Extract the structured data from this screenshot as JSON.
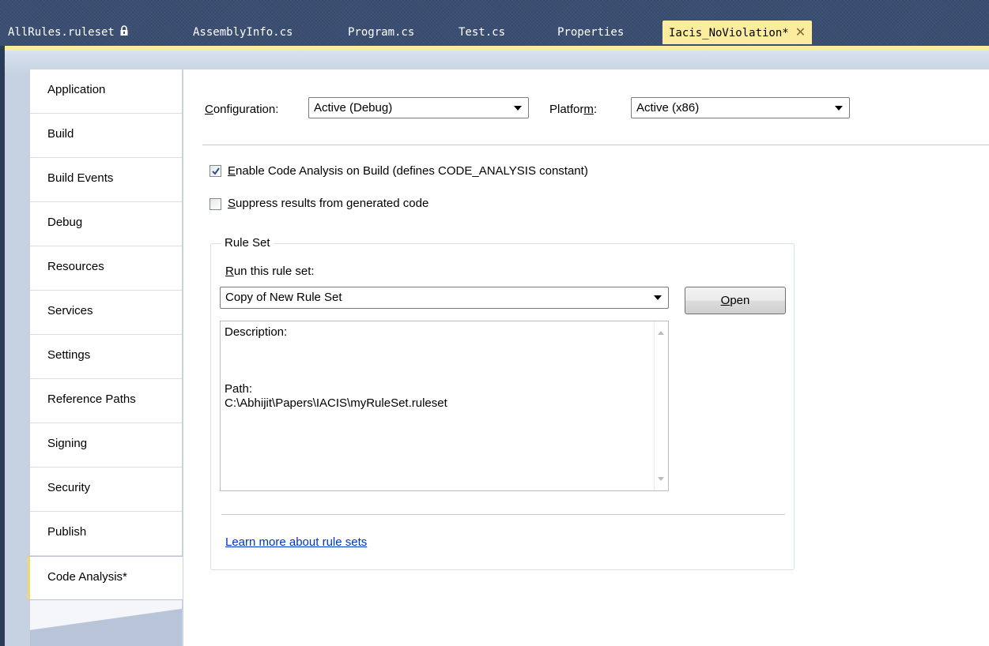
{
  "doc_tabs": [
    {
      "label": "AllRules.ruleset"
    },
    {
      "label": "AssemblyInfo.cs"
    },
    {
      "label": "Program.cs"
    },
    {
      "label": "Test.cs"
    },
    {
      "label": "Properties"
    },
    {
      "label": "Iacis_NoViolation*",
      "active": true
    }
  ],
  "sidebar": {
    "items": [
      {
        "label": "Application"
      },
      {
        "label": "Build"
      },
      {
        "label": "Build Events"
      },
      {
        "label": "Debug"
      },
      {
        "label": "Resources"
      },
      {
        "label": "Services"
      },
      {
        "label": "Settings"
      },
      {
        "label": "Reference Paths"
      },
      {
        "label": "Signing"
      },
      {
        "label": "Security"
      },
      {
        "label": "Publish"
      },
      {
        "label": "Code Analysis*",
        "active": true
      }
    ]
  },
  "config": {
    "config_label_accel": "C",
    "config_label_rest": "onfiguration:",
    "config_value": "Active (Debug)",
    "platform_label_pre": "Platfor",
    "platform_label_accel": "m",
    "platform_label_post": ":",
    "platform_value": "Active (x86)"
  },
  "options": {
    "enable_accel": "E",
    "enable_rest": "nable Code Analysis on Build (defines CODE_ANALYSIS constant)",
    "enable_checked": true,
    "suppress_accel": "S",
    "suppress_rest": "uppress results from generated code",
    "suppress_checked": false
  },
  "rule_set": {
    "group_title": "Rule Set",
    "run_label_accel": "R",
    "run_label_rest": "un this rule set:",
    "selected": "Copy of New Rule Set",
    "open_accel": "O",
    "open_rest": "pen",
    "description_label": "Description:",
    "path_label": "Path:",
    "path_value": "C:\\Abhijit\\Papers\\IACIS\\myRuleSet.ruleset",
    "learn_more": "Learn more about rule sets"
  },
  "colors": {
    "active_tab": "#fcec9e",
    "background": "#2b3c59",
    "link": "#0033cc"
  }
}
